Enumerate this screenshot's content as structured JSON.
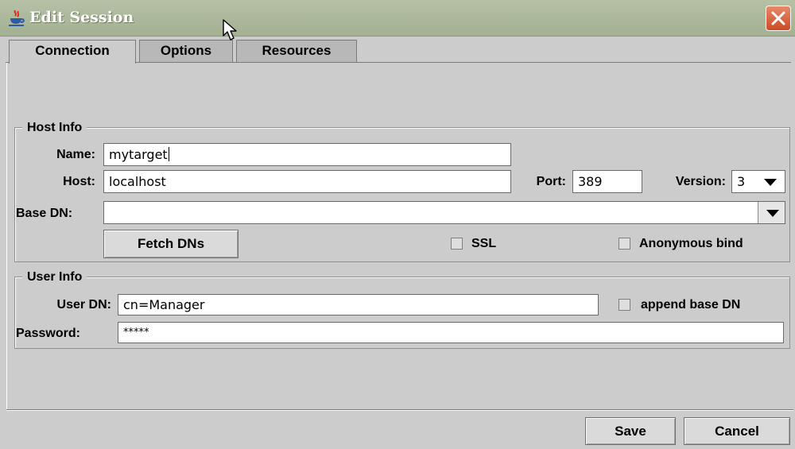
{
  "window": {
    "title": "Edit Session",
    "colors": {
      "titlebar": "#a9b597",
      "close_button": "#d85a33",
      "panel": "#cccccc"
    }
  },
  "tabs": [
    {
      "label": "Connection",
      "active": true
    },
    {
      "label": "Options",
      "active": false
    },
    {
      "label": "Resources",
      "active": false
    }
  ],
  "host_info": {
    "title": "Host Info",
    "name_label": "Name:",
    "name_value": "mytarget",
    "host_label": "Host:",
    "host_value": "localhost",
    "port_label": "Port:",
    "port_value": "389",
    "version_label": "Version:",
    "version_value": "3",
    "base_dn_label": "Base DN:",
    "base_dn_value": "",
    "fetch_dns_label": "Fetch DNs",
    "ssl_label": "SSL",
    "ssl_checked": false,
    "anonymous_label": "Anonymous bind",
    "anonymous_checked": false
  },
  "user_info": {
    "title": "User Info",
    "user_dn_label": "User DN:",
    "user_dn_value": "cn=Manager",
    "append_label": "append base DN",
    "append_checked": false,
    "password_label": "Password:",
    "password_value": "*****"
  },
  "footer": {
    "save_label": "Save",
    "cancel_label": "Cancel"
  },
  "icons": {
    "app": "java-cup-icon",
    "close": "close-icon",
    "cursor": "mouse-cursor-icon",
    "dropdown": "triangle-down-icon"
  }
}
